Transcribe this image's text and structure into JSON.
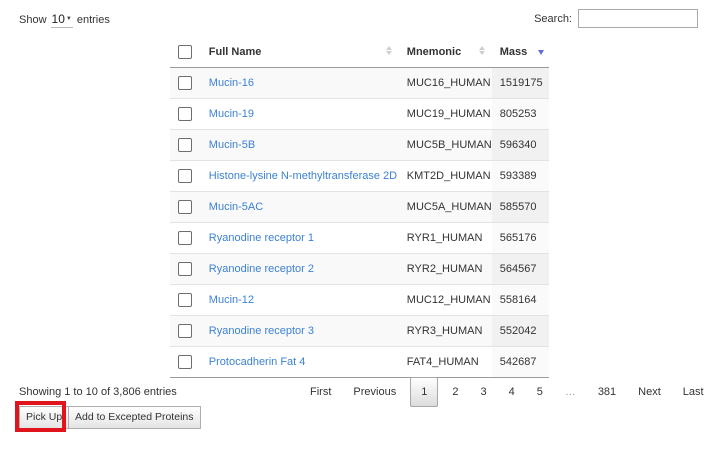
{
  "length_control": {
    "prefix": "Show",
    "value": "10",
    "suffix": "entries"
  },
  "search": {
    "label": "Search:",
    "value": ""
  },
  "table": {
    "headers": {
      "full_name": "Full Name",
      "mnemonic": "Mnemonic",
      "mass": "Mass"
    },
    "sort": {
      "column": "mass",
      "direction": "descending"
    },
    "rows": [
      {
        "full_name": "Mucin-16",
        "mnemonic": "MUC16_HUMAN",
        "mass": "1519175"
      },
      {
        "full_name": "Mucin-19",
        "mnemonic": "MUC19_HUMAN",
        "mass": "805253"
      },
      {
        "full_name": "Mucin-5B",
        "mnemonic": "MUC5B_HUMAN",
        "mass": "596340"
      },
      {
        "full_name": "Histone-lysine N-methyltransferase 2D",
        "mnemonic": "KMT2D_HUMAN",
        "mass": "593389"
      },
      {
        "full_name": "Mucin-5AC",
        "mnemonic": "MUC5A_HUMAN",
        "mass": "585570"
      },
      {
        "full_name": "Ryanodine receptor 1",
        "mnemonic": "RYR1_HUMAN",
        "mass": "565176"
      },
      {
        "full_name": "Ryanodine receptor 2",
        "mnemonic": "RYR2_HUMAN",
        "mass": "564567"
      },
      {
        "full_name": "Mucin-12",
        "mnemonic": "MUC12_HUMAN",
        "mass": "558164"
      },
      {
        "full_name": "Ryanodine receptor 3",
        "mnemonic": "RYR3_HUMAN",
        "mass": "552042"
      },
      {
        "full_name": "Protocadherin Fat 4",
        "mnemonic": "FAT4_HUMAN",
        "mass": "542687"
      }
    ]
  },
  "info": "Showing 1 to 10 of 3,806 entries",
  "pagination": {
    "first": "First",
    "previous": "Previous",
    "pages": [
      "1",
      "2",
      "3",
      "4",
      "5"
    ],
    "current": "1",
    "ellipsis": "…",
    "last_page": "381",
    "next": "Next",
    "last": "Last"
  },
  "buttons": {
    "pick_up": "Pick Up",
    "add_excepted": "Add to Excepted Proteins"
  },
  "colors": {
    "link": "#3c82d2",
    "highlight": "#e0141c",
    "sort_active": "#5b6fd6"
  }
}
